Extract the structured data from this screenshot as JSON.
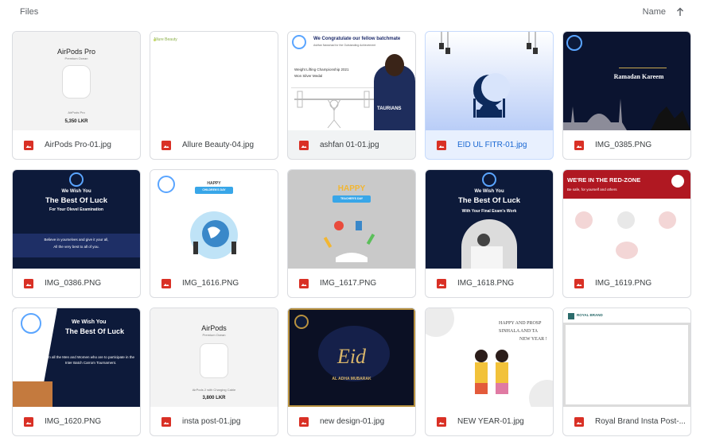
{
  "header": {
    "title": "Files",
    "sort_label": "Name"
  },
  "colors": {
    "image_icon": "#d93025",
    "selected_bg": "#e8f0fe",
    "selected_text": "#1967d2",
    "navy": "#0d1a3a"
  },
  "files": [
    {
      "name": "AirPods Pro-01.jpg",
      "thumb": {
        "title": "AirPods Pro",
        "subtitle": "Premium Ocean",
        "caption": "AirPods Pro",
        "price": "5,350 LKR"
      }
    },
    {
      "name": "Allure Beauty-04.jpg",
      "thumb": {
        "brand": "Allure Beauty"
      }
    },
    {
      "name": "ashfan 01-01.jpg",
      "thumb": {
        "headline": "We Congratulate our fellow batchmate",
        "sub": "Ashfan Nawshad for the Outstanding Achievement",
        "event": "Weight Lifting Championship 2021",
        "medal": "Won Silver Medal",
        "jersey": "TAURIANS"
      }
    },
    {
      "name": "EID UL FITR-01.jpg",
      "selected": true,
      "thumb": {}
    },
    {
      "name": "IMG_0385.PNG",
      "thumb": {
        "title": "Ramadan Kareem"
      }
    },
    {
      "name": "IMG_0386.PNG",
      "thumb": {
        "line1": "We Wish You",
        "line2": "The Best Of Luck",
        "line3": "For Your Olevel Examination",
        "body1": "Believe in yourselves and give it your all,",
        "body2": "All the very best to all of you."
      }
    },
    {
      "name": "IMG_1616.PNG",
      "thumb": {
        "title1": "HAPPY",
        "title2": "CHILDREN'S DAY"
      }
    },
    {
      "name": "IMG_1617.PNG",
      "thumb": {
        "title1": "HAPPY",
        "title2": "TEACHER'S DAY"
      }
    },
    {
      "name": "IMG_1618.PNG",
      "thumb": {
        "line1": "We Wish You",
        "line2": "The Best Of Luck",
        "line3": "With Your Final Exam's Work"
      }
    },
    {
      "name": "IMG_1619.PNG",
      "thumb": {
        "headline": "WE'RE IN THE RED-ZONE",
        "sub": "Be safe, for yourself and others"
      }
    },
    {
      "name": "IMG_1620.PNG",
      "thumb": {
        "line1": "We Wish You",
        "line2": "The Best Of Luck",
        "body": "To all the Men and Women who are to participate in the Inter Batch Carrom Tournament."
      }
    },
    {
      "name": "insta post-01.jpg",
      "thumb": {
        "title": "AirPods",
        "subtitle": "Premium Ocean",
        "caption": "AirPods 2 with Charging Cable",
        "price": "3,800 LKR"
      }
    },
    {
      "name": "new design-01.jpg",
      "thumb": {
        "title": "Eid",
        "sub": "AL ADHA MUBARAK"
      }
    },
    {
      "name": "NEW YEAR-01.jpg",
      "thumb": {
        "line1": "HAPPY AND PROSP",
        "line2": "SINHALA AND TA",
        "line3": "NEW YEAR !"
      }
    },
    {
      "name": "Royal Brand Insta Post-...",
      "thumb": {
        "brand": "ROYAL BRAND"
      }
    }
  ]
}
